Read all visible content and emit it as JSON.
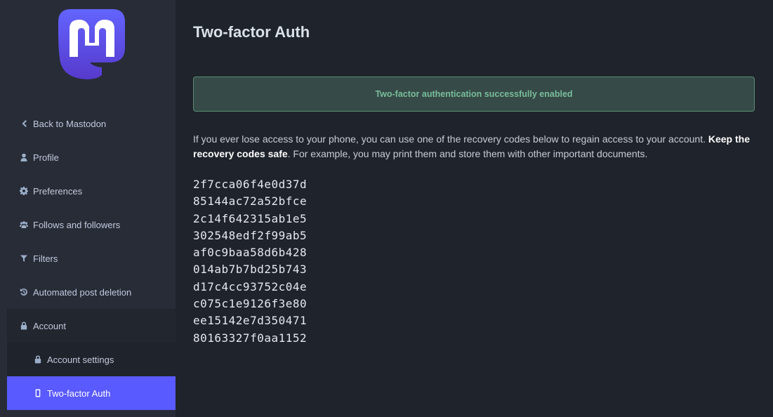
{
  "sidebar": {
    "logo": "mastodon-logo",
    "items": [
      {
        "label": "Back to Mastodon",
        "icon": "chevron-left-icon"
      },
      {
        "label": "Profile",
        "icon": "user-icon"
      },
      {
        "label": "Preferences",
        "icon": "gear-icon"
      },
      {
        "label": "Follows and followers",
        "icon": "users-icon"
      },
      {
        "label": "Filters",
        "icon": "filter-icon"
      },
      {
        "label": "Automated post deletion",
        "icon": "history-icon"
      }
    ],
    "account": {
      "label": "Account",
      "icon": "lock-icon",
      "children": [
        {
          "label": "Account settings",
          "icon": "lock-icon"
        },
        {
          "label": "Two-factor Auth",
          "icon": "mobile-icon",
          "active": true
        }
      ]
    }
  },
  "main": {
    "title": "Two-factor Auth",
    "flash": "Two-factor authentication successfully enabled",
    "hint_text": "If you ever lose access to your phone, you can use one of the recovery codes below to regain access to your account. ",
    "hint_bold": "Keep the recovery codes safe",
    "hint_after": ". For example, you may print them and store them with other important documents.",
    "recovery_codes": [
      "2f7cca06f4e0d37d",
      "85144ac72a52bfce",
      "2c14f642315ab1e5",
      "302548edf2f99ab5",
      "af0c9baa58d6b428",
      "014ab7b7bd25b743",
      "d17c4cc93752c04e",
      "c075c1e9126f3e80",
      "ee15142e7d350471",
      "80163327f0aa1152"
    ]
  },
  "colors": {
    "accent": "#595aff",
    "success_text": "#79bd9a",
    "sidebar_bg": "#282c37",
    "main_bg": "#1f232b"
  }
}
